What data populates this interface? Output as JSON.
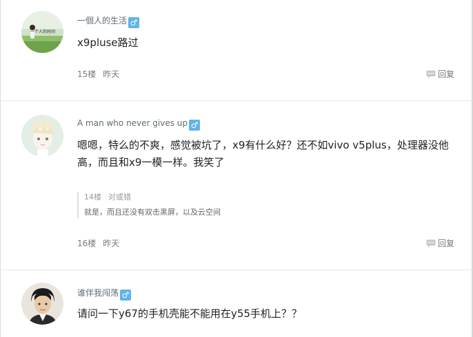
{
  "comments": [
    {
      "username": "一個人的生活",
      "gender_icon": "male-icon",
      "avatar_icon": "avatar-field-person",
      "content": "x9pluse路过",
      "floor": "15楼",
      "time": "昨天",
      "reply_label": "回复"
    },
    {
      "username": "A man who never gives up",
      "gender_icon": "male-icon",
      "avatar_icon": "avatar-anime-boy",
      "content": "嗯嗯，特么的不爽，感觉被坑了，x9有什么好？还不如vivo v5plus，处理器没他高，而且和x9一模一样。我笑了",
      "quote": {
        "floor": "14楼",
        "author": "对或错",
        "text": "就是，而且还没有双击黑屏，以及云空间"
      },
      "floor": "16楼",
      "time": "昨天",
      "reply_label": "回复"
    },
    {
      "username": "谁伴我闯荡",
      "gender_icon": "male-icon",
      "avatar_icon": "avatar-man-portrait",
      "content": "请问一下y67的手机壳能不能用在y55手机上？？"
    }
  ],
  "avatar_text": "一个人的时间",
  "colors": {
    "gender_badge": "#5fb4e8",
    "username": "#5f6b73",
    "meta": "#7a7a7a"
  }
}
